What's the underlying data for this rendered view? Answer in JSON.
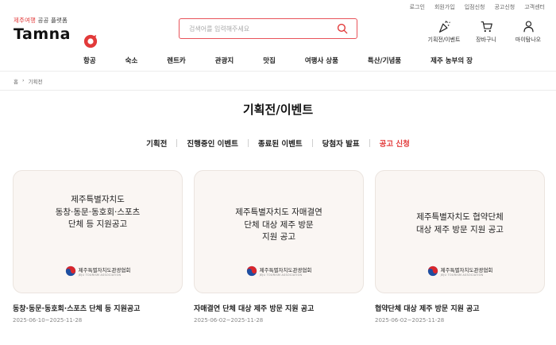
{
  "util_links": [
    "로그인",
    "회원가입",
    "입점신청",
    "공고신청",
    "고객센터"
  ],
  "logo": {
    "tag_red": "제주여행",
    "tag_gray": " 공공 플랫폼",
    "word": "Tamna"
  },
  "search": {
    "placeholder": "검색어를 입력해주세요",
    "value": ""
  },
  "header_icons": [
    {
      "label": "기획전/이벤트",
      "icon": "party-popper-icon"
    },
    {
      "label": "장바구니",
      "icon": "cart-icon"
    },
    {
      "label": "마이탐나오",
      "icon": "user-icon"
    }
  ],
  "nav": [
    "항공",
    "숙소",
    "렌트카",
    "관광지",
    "맛집",
    "여행사 상품",
    "특산/기념품",
    "제주 농부의 장"
  ],
  "breadcrumb": {
    "home": "홈",
    "sep": "›",
    "current": "기획전"
  },
  "page_title": "기획전/이벤트",
  "tabs": [
    "기획전",
    "진행중인 이벤트",
    "종료된 이벤트",
    "당첨자 발표",
    "공고 신청"
  ],
  "active_tab": "공고 신청",
  "colors": {
    "accent": "#e23a3a",
    "card_bg": "#faf6f3"
  },
  "org_logo": {
    "name": "제주특별자치도관광협회",
    "sub": "JEJU TOURISM ASSOCIATION"
  },
  "cards": [
    {
      "lines": [
        "제주특별자치도",
        "동창·동문·동호회·스포츠",
        "단체 등 지원공고"
      ],
      "title": "동창·동문·동호회·스포츠 단체 등 지원공고",
      "date": "2025-06-10~2025-11-28"
    },
    {
      "lines": [
        "제주특별자치도 자매결연",
        "단체 대상 제주 방문",
        "지원 공고"
      ],
      "title": "자매결연 단체 대상 제주 방문 지원 공고",
      "date": "2025-06-02~2025-11-28"
    },
    {
      "lines": [
        "제주특별자치도 협약단체",
        "대상 제주 방문 지원 공고"
      ],
      "title": "협약단체 대상 제주 방문 지원 공고",
      "date": "2025-06-02~2025-11-28"
    }
  ]
}
